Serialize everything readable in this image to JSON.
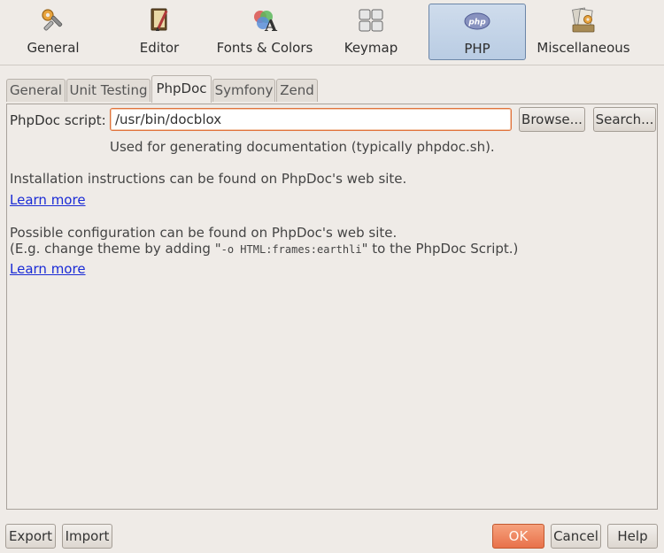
{
  "categories": [
    {
      "label": "General",
      "icon": "tools-icon"
    },
    {
      "label": "Editor",
      "icon": "editor-icon"
    },
    {
      "label": "Fonts & Colors",
      "icon": "fonts-colors-icon"
    },
    {
      "label": "Keymap",
      "icon": "keymap-icon"
    },
    {
      "label": "PHP",
      "icon": "php-icon",
      "selected": true
    },
    {
      "label": "Miscellaneous",
      "icon": "miscellaneous-icon"
    }
  ],
  "tabs": [
    {
      "label": "General"
    },
    {
      "label": "Unit Testing"
    },
    {
      "label": "PhpDoc",
      "active": true
    },
    {
      "label": "Symfony"
    },
    {
      "label": "Zend"
    }
  ],
  "phpdoc": {
    "script_label": "PhpDoc script:",
    "script_value": "/usr/bin/docblox",
    "browse_label": "Browse...",
    "search_label": "Search...",
    "hint": "Used for generating documentation (typically phpdoc.sh).",
    "install_text": "Installation instructions can be found on PhpDoc's web site.",
    "learn_more_1": "Learn more",
    "config_text": "Possible configuration can be found on PhpDoc's web site.",
    "example_prefix": "(E.g. change theme by adding \"",
    "example_code": "-o HTML:frames:earthli",
    "example_suffix": "\" to the PhpDoc Script.)",
    "learn_more_2": "Learn more"
  },
  "footer": {
    "export_label": "Export",
    "import_label": "Import",
    "ok_label": "OK",
    "cancel_label": "Cancel",
    "help_label": "Help"
  },
  "colors": {
    "accent": "#e8714a",
    "link": "#1a2bd6",
    "selected_category": "#b9cce3"
  }
}
